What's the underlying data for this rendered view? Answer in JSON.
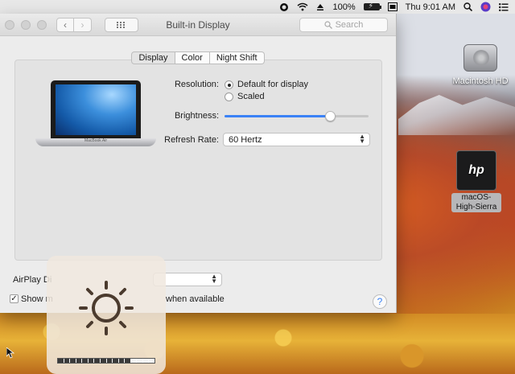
{
  "menubar": {
    "battery_percent": "100%",
    "clock": "Thu 9:01 AM",
    "icons": [
      "app-status-icon",
      "wifi-icon",
      "eject-icon",
      "battery-icon",
      "display-icon",
      "spotlight-icon",
      "siri-icon",
      "notification-center-icon"
    ]
  },
  "window": {
    "title": "Built-in Display",
    "search_placeholder": "Search",
    "tabs": [
      {
        "label": "Display",
        "active": true
      },
      {
        "label": "Color",
        "active": false
      },
      {
        "label": "Night Shift",
        "active": false
      }
    ],
    "laptop_badge": "MacBook Air",
    "resolution": {
      "label": "Resolution:",
      "options": [
        {
          "label": "Default for display",
          "selected": true
        },
        {
          "label": "Scaled",
          "selected": false
        }
      ]
    },
    "brightness": {
      "label": "Brightness:",
      "level": 0.73
    },
    "refresh_rate": {
      "label": "Refresh Rate:",
      "value": "60 Hertz"
    },
    "airplay": {
      "label": "AirPlay Di"
    },
    "show_mirroring": {
      "label_start": "Show m",
      "label_end": "when available",
      "checked": true
    },
    "help_label": "?"
  },
  "hud": {
    "type": "brightness",
    "filled_segments": 12,
    "total_segments": 16
  },
  "desktop": {
    "icons": [
      {
        "label": "Macintosh HD",
        "type": "hard-drive"
      },
      {
        "label": "macOS-High-Sierra",
        "type": "hp-disk",
        "selected": true
      }
    ]
  }
}
